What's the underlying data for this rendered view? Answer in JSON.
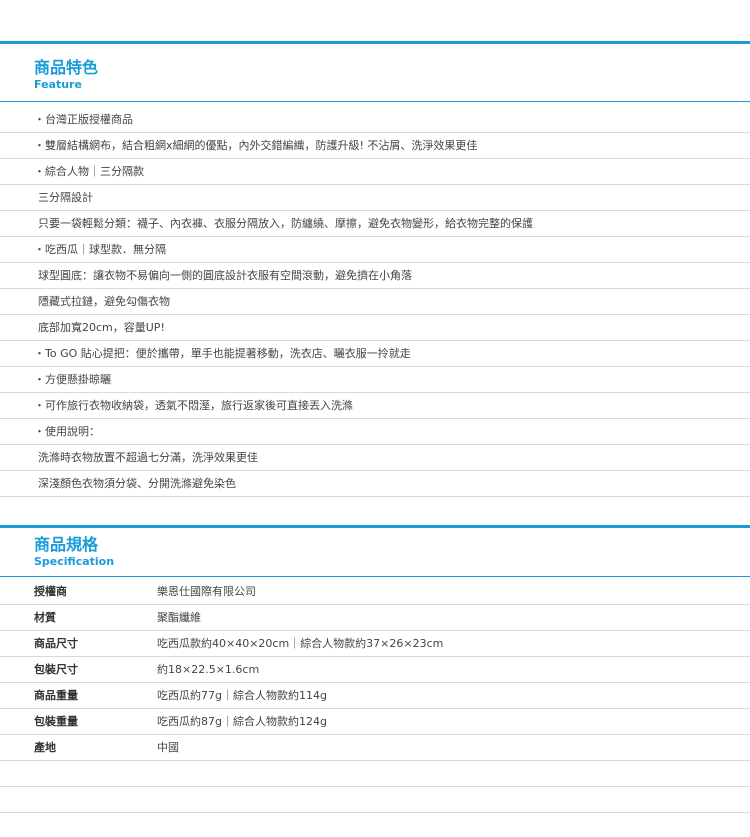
{
  "feature": {
    "title": "商品特色",
    "subtitle": "Feature",
    "items": [
      {
        "text": "・台灣正版授權商品",
        "indent": "bullet"
      },
      {
        "text": "・雙層結構網布，結合粗網x細網的優點，內外交錯編織，防護升級! 不沾屑、洗淨效果更佳",
        "indent": "bullet"
      },
      {
        "text": "・綜合人物｜三分隔款",
        "indent": "bullet"
      },
      {
        "text": "三分隔設計",
        "indent": "sub"
      },
      {
        "text": "只要一袋輕鬆分類：襪子、內衣褲、衣服分隔放入，防纏繞、摩擦，避免衣物變形，給衣物完整的保護",
        "indent": "sub"
      },
      {
        "text": "・吃西瓜｜球型款．無分隔",
        "indent": "bullet"
      },
      {
        "text": "球型圓底：讓衣物不易偏向一側的圓底設計衣服有空間滾動，避免擠在小角落",
        "indent": "sub"
      },
      {
        "text": "隱藏式拉鏈，避免勾傷衣物",
        "indent": "sub"
      },
      {
        "text": "底部加寬20cm，容量UP!",
        "indent": "sub"
      },
      {
        "text": "・To GO 貼心提把：便於攜帶，單手也能提著移動，洗衣店、曬衣服一拎就走",
        "indent": "bullet"
      },
      {
        "text": "・方便懸掛晾曬",
        "indent": "bullet"
      },
      {
        "text": "・可作旅行衣物收納袋，透氣不悶溼，旅行返家後可直接丟入洗滌",
        "indent": "bullet"
      },
      {
        "text": "・使用說明：",
        "indent": "bullet"
      },
      {
        "text": "洗滌時衣物放置不超過七分滿，洗淨效果更佳",
        "indent": "sub"
      },
      {
        "text": "深淺顏色衣物須分袋、分開洗滌避免染色",
        "indent": "sub"
      }
    ]
  },
  "spec": {
    "title": "商品規格",
    "subtitle": "Specification",
    "rows": [
      {
        "label": "授權商",
        "value": "樂恩仕國際有限公司"
      },
      {
        "label": "材質",
        "value": "聚酯纖維"
      },
      {
        "label": "商品尺寸",
        "value": "吃西瓜款約40×40×20cm｜綜合人物款約37×26×23cm"
      },
      {
        "label": "包裝尺寸",
        "value": "約18×22.5×1.6cm"
      },
      {
        "label": "商品重量",
        "value": "吃西瓜約77g｜綜合人物款約114g"
      },
      {
        "label": "包裝重量",
        "value": "吃西瓜約87g｜綜合人物款約124g"
      },
      {
        "label": "產地",
        "value": "中國"
      },
      {
        "label": "",
        "value": ""
      },
      {
        "label": "",
        "value": ""
      }
    ]
  },
  "colors": {
    "accent": "#1a9cd8",
    "rule": "#d9d9d9",
    "text": "#444444"
  }
}
